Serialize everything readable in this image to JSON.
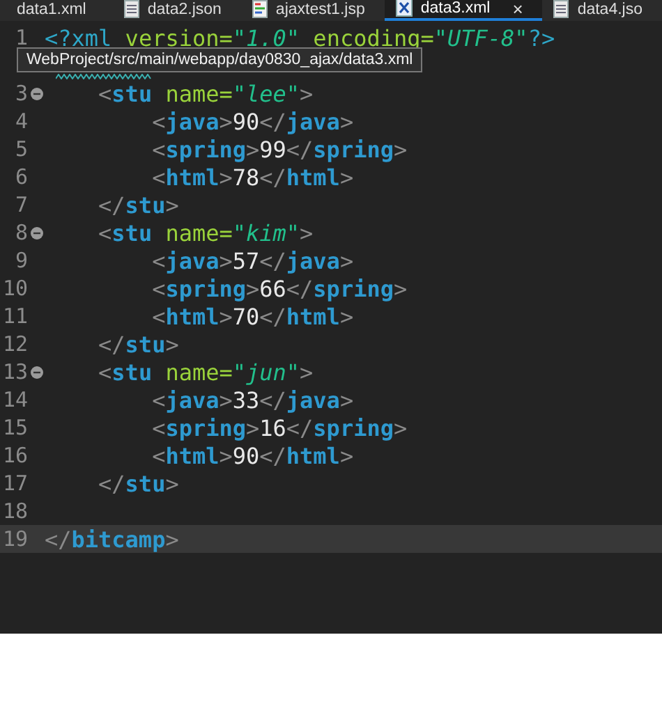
{
  "tabs": [
    {
      "label": "data1.xml",
      "kind": "plain",
      "selected": false
    },
    {
      "label": "data2.json",
      "kind": "doc",
      "selected": false
    },
    {
      "label": "ajaxtest1.jsp",
      "kind": "jsp",
      "selected": false
    },
    {
      "label": "data3.xml",
      "kind": "xml",
      "selected": true,
      "close": "×"
    },
    {
      "label": "data4.jso",
      "kind": "doc",
      "selected": false
    }
  ],
  "tooltip": "WebProject/src/main/webapp/day0830_ajax/data3.xml",
  "lines": [
    {
      "number": "1",
      "fold": false,
      "current": false,
      "warning": false,
      "tokens": [
        {
          "kind": "pi",
          "text": "<?xml"
        },
        {
          "kind": "attr",
          "text": " version="
        },
        {
          "kind": "value",
          "text": "\"1.0\""
        },
        {
          "kind": "attr",
          "text": " encoding="
        },
        {
          "kind": "value",
          "text": "\"UTF-8\""
        },
        {
          "kind": "pi",
          "text": "?>"
        }
      ]
    },
    {
      "fold": false,
      "current": false,
      "warning": true
    },
    {
      "number": "3",
      "fold": true,
      "current": false,
      "warning": false,
      "tokens": [
        {
          "kind": "bracket",
          "text": "    <"
        },
        {
          "kind": "tag",
          "text": "stu"
        },
        {
          "kind": "attr",
          "text": " name="
        },
        {
          "kind": "value",
          "text": "\"lee\""
        },
        {
          "kind": "bracket",
          "text": ">"
        }
      ]
    },
    {
      "number": "4",
      "fold": false,
      "current": false,
      "warning": false,
      "tokens": [
        {
          "kind": "bracket",
          "text": "        <"
        },
        {
          "kind": "tag",
          "text": "java"
        },
        {
          "kind": "bracket",
          "text": ">"
        },
        {
          "kind": "text",
          "text": "90"
        },
        {
          "kind": "bracket",
          "text": "</"
        },
        {
          "kind": "tag",
          "text": "java"
        },
        {
          "kind": "bracket",
          "text": ">"
        }
      ]
    },
    {
      "number": "5",
      "fold": false,
      "current": false,
      "warning": false,
      "tokens": [
        {
          "kind": "bracket",
          "text": "        <"
        },
        {
          "kind": "tag",
          "text": "spring"
        },
        {
          "kind": "bracket",
          "text": ">"
        },
        {
          "kind": "text",
          "text": "99"
        },
        {
          "kind": "bracket",
          "text": "</"
        },
        {
          "kind": "tag",
          "text": "spring"
        },
        {
          "kind": "bracket",
          "text": ">"
        }
      ]
    },
    {
      "number": "6",
      "fold": false,
      "current": false,
      "warning": false,
      "tokens": [
        {
          "kind": "bracket",
          "text": "        <"
        },
        {
          "kind": "tag",
          "text": "html"
        },
        {
          "kind": "bracket",
          "text": ">"
        },
        {
          "kind": "text",
          "text": "78"
        },
        {
          "kind": "bracket",
          "text": "</"
        },
        {
          "kind": "tag",
          "text": "html"
        },
        {
          "kind": "bracket",
          "text": ">"
        }
      ]
    },
    {
      "number": "7",
      "fold": false,
      "current": false,
      "warning": false,
      "tokens": [
        {
          "kind": "bracket",
          "text": "    </"
        },
        {
          "kind": "tag",
          "text": "stu"
        },
        {
          "kind": "bracket",
          "text": ">"
        }
      ]
    },
    {
      "number": "8",
      "fold": true,
      "current": false,
      "warning": false,
      "tokens": [
        {
          "kind": "bracket",
          "text": "    <"
        },
        {
          "kind": "tag",
          "text": "stu"
        },
        {
          "kind": "attr",
          "text": " name="
        },
        {
          "kind": "value",
          "text": "\"kim\""
        },
        {
          "kind": "bracket",
          "text": ">"
        }
      ]
    },
    {
      "number": "9",
      "fold": false,
      "current": false,
      "warning": false,
      "tokens": [
        {
          "kind": "bracket",
          "text": "        <"
        },
        {
          "kind": "tag",
          "text": "java"
        },
        {
          "kind": "bracket",
          "text": ">"
        },
        {
          "kind": "text",
          "text": "57"
        },
        {
          "kind": "bracket",
          "text": "</"
        },
        {
          "kind": "tag",
          "text": "java"
        },
        {
          "kind": "bracket",
          "text": ">"
        }
      ]
    },
    {
      "number": "10",
      "fold": false,
      "current": false,
      "warning": false,
      "tokens": [
        {
          "kind": "bracket",
          "text": "        <"
        },
        {
          "kind": "tag",
          "text": "spring"
        },
        {
          "kind": "bracket",
          "text": ">"
        },
        {
          "kind": "text",
          "text": "66"
        },
        {
          "kind": "bracket",
          "text": "</"
        },
        {
          "kind": "tag",
          "text": "spring"
        },
        {
          "kind": "bracket",
          "text": ">"
        }
      ]
    },
    {
      "number": "11",
      "fold": false,
      "current": false,
      "warning": false,
      "tokens": [
        {
          "kind": "bracket",
          "text": "        <"
        },
        {
          "kind": "tag",
          "text": "html"
        },
        {
          "kind": "bracket",
          "text": ">"
        },
        {
          "kind": "text",
          "text": "70"
        },
        {
          "kind": "bracket",
          "text": "</"
        },
        {
          "kind": "tag",
          "text": "html"
        },
        {
          "kind": "bracket",
          "text": ">"
        }
      ]
    },
    {
      "number": "12",
      "fold": false,
      "current": false,
      "warning": false,
      "tokens": [
        {
          "kind": "bracket",
          "text": "    </"
        },
        {
          "kind": "tag",
          "text": "stu"
        },
        {
          "kind": "bracket",
          "text": ">"
        }
      ]
    },
    {
      "number": "13",
      "fold": true,
      "current": false,
      "warning": false,
      "tokens": [
        {
          "kind": "bracket",
          "text": "    <"
        },
        {
          "kind": "tag",
          "text": "stu"
        },
        {
          "kind": "attr",
          "text": " name="
        },
        {
          "kind": "value",
          "text": "\"jun\""
        },
        {
          "kind": "bracket",
          "text": ">"
        }
      ]
    },
    {
      "number": "14",
      "fold": false,
      "current": false,
      "warning": false,
      "tokens": [
        {
          "kind": "bracket",
          "text": "        <"
        },
        {
          "kind": "tag",
          "text": "java"
        },
        {
          "kind": "bracket",
          "text": ">"
        },
        {
          "kind": "text",
          "text": "33"
        },
        {
          "kind": "bracket",
          "text": "</"
        },
        {
          "kind": "tag",
          "text": "java"
        },
        {
          "kind": "bracket",
          "text": ">"
        }
      ]
    },
    {
      "number": "15",
      "fold": false,
      "current": false,
      "warning": false,
      "tokens": [
        {
          "kind": "bracket",
          "text": "        <"
        },
        {
          "kind": "tag",
          "text": "spring"
        },
        {
          "kind": "bracket",
          "text": ">"
        },
        {
          "kind": "text",
          "text": "16"
        },
        {
          "kind": "bracket",
          "text": "</"
        },
        {
          "kind": "tag",
          "text": "spring"
        },
        {
          "kind": "bracket",
          "text": ">"
        }
      ]
    },
    {
      "number": "16",
      "fold": false,
      "current": false,
      "warning": false,
      "tokens": [
        {
          "kind": "bracket",
          "text": "        <"
        },
        {
          "kind": "tag",
          "text": "html"
        },
        {
          "kind": "bracket",
          "text": ">"
        },
        {
          "kind": "text",
          "text": "90"
        },
        {
          "kind": "bracket",
          "text": "</"
        },
        {
          "kind": "tag",
          "text": "html"
        },
        {
          "kind": "bracket",
          "text": ">"
        }
      ]
    },
    {
      "number": "17",
      "fold": false,
      "current": false,
      "warning": false,
      "tokens": [
        {
          "kind": "bracket",
          "text": "    </"
        },
        {
          "kind": "tag",
          "text": "stu"
        },
        {
          "kind": "bracket",
          "text": ">"
        }
      ]
    },
    {
      "number": "18",
      "fold": false,
      "current": false,
      "warning": false
    },
    {
      "number": "19",
      "fold": false,
      "current": true,
      "warning": false,
      "tokens": [
        {
          "kind": "bracket",
          "text": "</"
        },
        {
          "kind": "tag",
          "text": "bitcamp"
        },
        {
          "kind": "bracket",
          "text": ">"
        }
      ]
    }
  ]
}
